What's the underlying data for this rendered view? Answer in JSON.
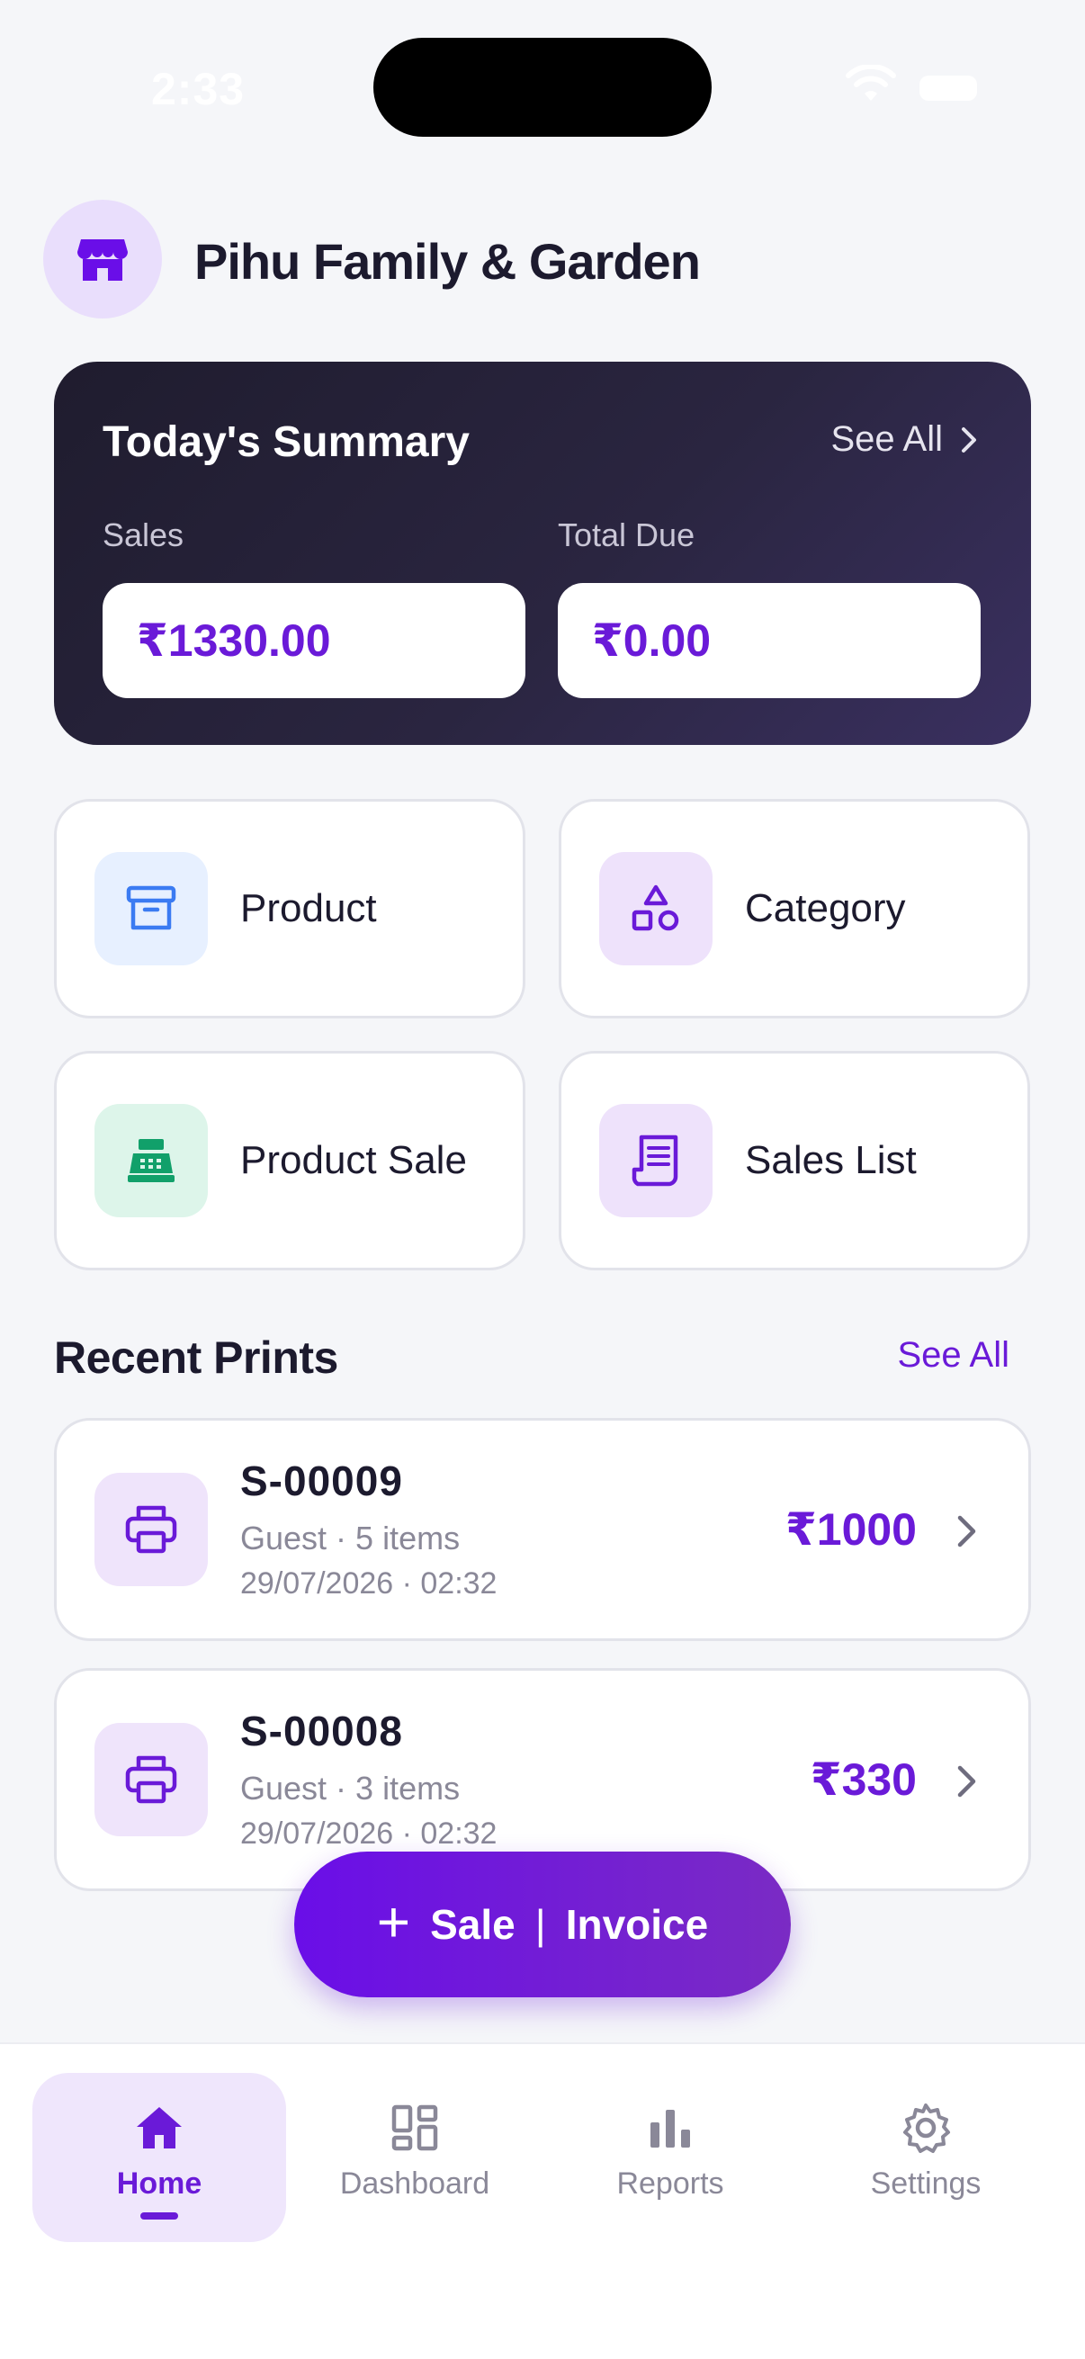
{
  "status_bar": {
    "time": "2:33"
  },
  "store": {
    "name": "Pihu Family & Garden"
  },
  "summary": {
    "title": "Today's Summary",
    "see_all": "See All",
    "sales_label": "Sales",
    "sales_value": "₹1330.00",
    "due_label": "Total Due",
    "due_value": "₹0.00"
  },
  "tiles": [
    {
      "label": "Product",
      "icon": "archive-box-icon",
      "color": "#3B7BF2",
      "bg": "#E7F0FF"
    },
    {
      "label": "Category",
      "icon": "shapes-icon",
      "color": "#6A1AD8",
      "bg": "#EEE2FB"
    },
    {
      "label": "Product Sale",
      "icon": "cash-register-icon",
      "color": "#11A06A",
      "bg": "#DDF5EA"
    },
    {
      "label": "Sales List",
      "icon": "receipt-icon",
      "color": "#6A1AD8",
      "bg": "#EEE2FB"
    }
  ],
  "recent_prints": {
    "title": "Recent Prints",
    "see_all": "See All",
    "items": [
      {
        "id": "S-00009",
        "meta": "Guest · 5 items",
        "date": "29/07/2026 · 02:32",
        "amount": "₹1000"
      },
      {
        "id": "S-00008",
        "meta": "Guest · 3 items",
        "date": "29/07/2026 · 02:32",
        "amount": "₹330"
      }
    ]
  },
  "fab": {
    "plus": "+",
    "label_left": "Sale",
    "separator": "|",
    "label_right": "Invoice"
  },
  "nav": [
    {
      "label": "Home",
      "icon": "home-icon",
      "active": true
    },
    {
      "label": "Dashboard",
      "icon": "dashboard-icon",
      "active": false
    },
    {
      "label": "Reports",
      "icon": "bar-chart-icon",
      "active": false
    },
    {
      "label": "Settings",
      "icon": "gear-icon",
      "active": false
    }
  ],
  "colors": {
    "accent": "#6A1AD8",
    "background": "#F5F6F9",
    "text": "#1C1A2E",
    "muted": "#8A8898"
  }
}
